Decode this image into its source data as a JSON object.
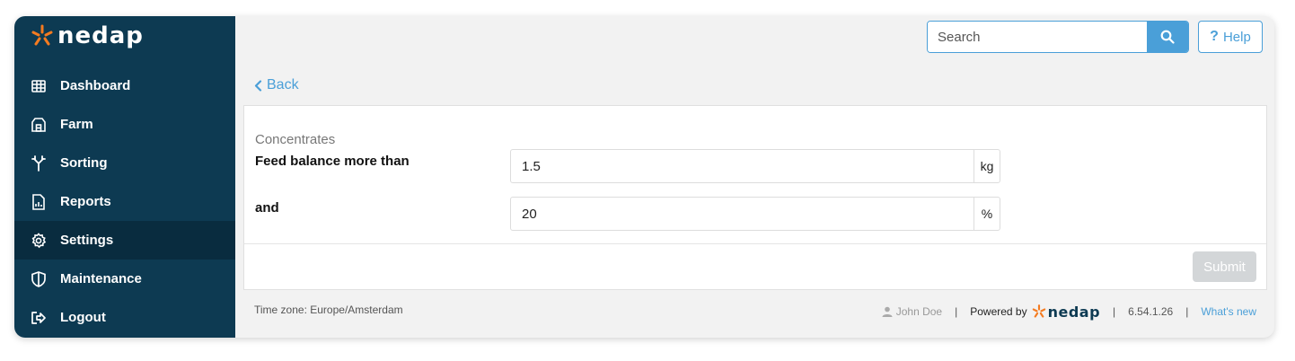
{
  "brand": {
    "name": "nedap"
  },
  "sidebar": {
    "items": [
      {
        "label": "Dashboard",
        "icon": "grid-icon"
      },
      {
        "label": "Farm",
        "icon": "barn-icon"
      },
      {
        "label": "Sorting",
        "icon": "fork-icon"
      },
      {
        "label": "Reports",
        "icon": "report-icon"
      },
      {
        "label": "Settings",
        "icon": "gear-icon",
        "active": true
      },
      {
        "label": "Maintenance",
        "icon": "shield-icon"
      },
      {
        "label": "Logout",
        "icon": "logout-icon"
      }
    ]
  },
  "header": {
    "search_placeholder": "Search",
    "help_label": "Help"
  },
  "back_label": "Back",
  "form": {
    "section_title": "Concentrates",
    "field1": {
      "label": "Feed balance more than",
      "value": "1.5",
      "unit": "kg"
    },
    "field2": {
      "label": "and",
      "value": "20",
      "unit": "%"
    },
    "submit_label": "Submit"
  },
  "footer": {
    "timezone": "Time zone: Europe/Amsterdam",
    "user": "John Doe",
    "powered_by": "Powered by",
    "powered_logo": "nedap",
    "version": "6.54.1.26",
    "whats_new": "What's new"
  },
  "colors": {
    "sidebar_bg": "#0d3a52",
    "sidebar_active": "#092c3f",
    "accent": "#4a9fd8",
    "logo_star": "#f47b20",
    "submit_disabled": "#d3d6d8"
  }
}
